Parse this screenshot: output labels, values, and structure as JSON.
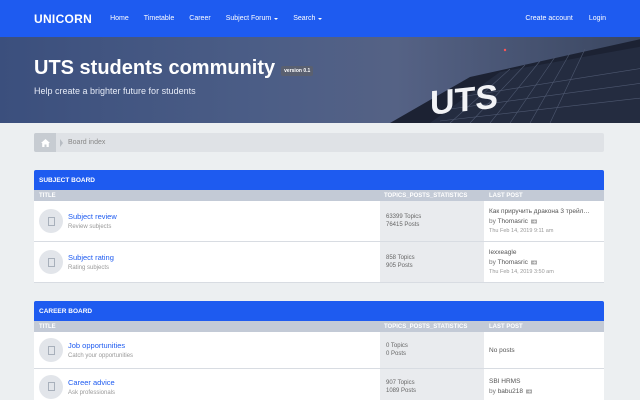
{
  "nav": {
    "brand": "UNICORN",
    "links": [
      "Home",
      "Timetable",
      "Career",
      "Subject Forum",
      "Search"
    ],
    "right": [
      "Create account",
      "Login"
    ]
  },
  "hero": {
    "title": "UTS students community",
    "version": "version 0.1",
    "subtitle": "Help create a brighter future for students"
  },
  "breadcrumb": {
    "label": "Board index"
  },
  "columns": {
    "title": "TITLE",
    "stats": "TOPICS_POSTS_STATISTICS",
    "last": "LAST POST"
  },
  "boards": [
    {
      "name": "SUBJECT BOARD",
      "forums": [
        {
          "name": "Subject review",
          "desc": "Review subjects",
          "topics": "63399 Topics",
          "posts": "76415 Posts",
          "last_title": "Как приручить дракона 3 трейл…",
          "last_by_prefix": "by",
          "last_by": "Thomasric",
          "last_date": "Thu Feb 14, 2019 9:11 am"
        },
        {
          "name": "Subject rating",
          "desc": "Rating subjects",
          "topics": "858 Topics",
          "posts": "905 Posts",
          "last_title": "lexxeagle",
          "last_by_prefix": "by",
          "last_by": "Thomasric",
          "last_date": "Thu Feb 14, 2019 3:50 am"
        }
      ]
    },
    {
      "name": "CAREER BOARD",
      "forums": [
        {
          "name": "Job opportunities",
          "desc": "Catch your opportunities",
          "topics": "0 Topics",
          "posts": "0 Posts",
          "no_posts": "No posts"
        },
        {
          "name": "Career advice",
          "desc": "Ask professionals",
          "topics": "907 Topics",
          "posts": "1089 Posts",
          "last_title": "SBI HRMS",
          "last_by_prefix": "by",
          "last_by": "babu218"
        }
      ]
    }
  ],
  "colors": {
    "accent": "#1e5bf0",
    "header_row": "#c3cad6",
    "background": "#eceff1"
  }
}
